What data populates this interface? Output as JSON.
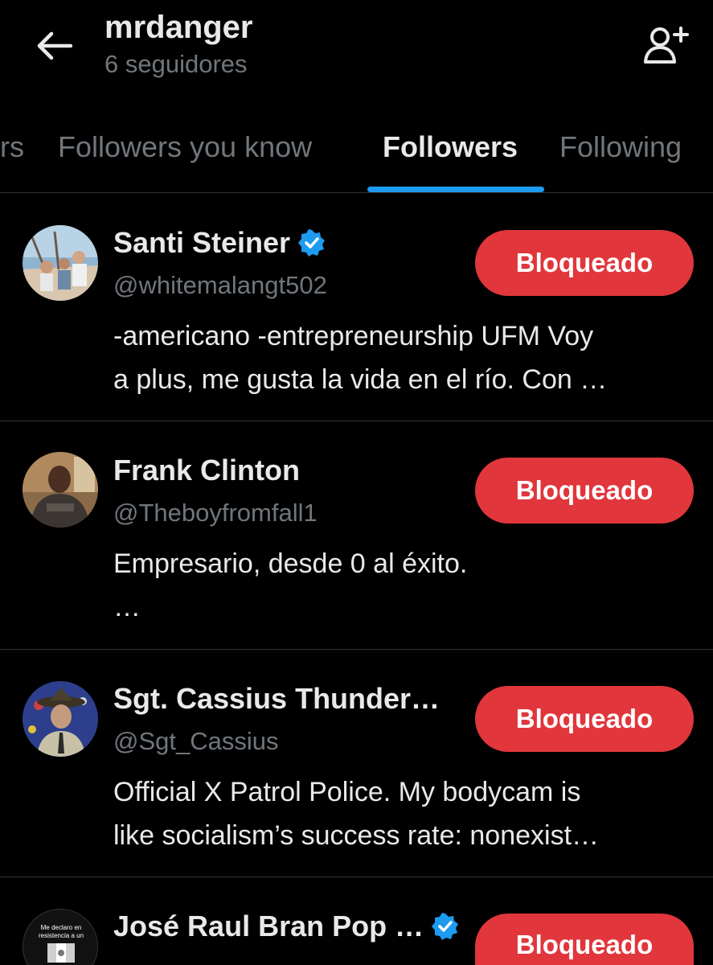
{
  "header": {
    "title": "mrdanger",
    "subtitle": "6 seguidores"
  },
  "tabs": [
    {
      "label": "rs"
    },
    {
      "label": "Followers you know"
    },
    {
      "label": "Followers"
    },
    {
      "label": "Following"
    }
  ],
  "active_tab": "Followers",
  "accounts": [
    {
      "name": "Santi Steiner",
      "verified": true,
      "handle": "@whitemalangt502",
      "bio_line1": "-americano -entrepreneurship UFM Voy",
      "bio_line2": "a plus, me gusta la vida en el río. Con …",
      "button_label": "Bloqueado"
    },
    {
      "name": "Frank Clinton",
      "verified": false,
      "handle": "@Theboyfromfall1",
      "bio_line1": "Empresario, desde 0 al éxito.",
      "bio_line2": "…",
      "button_label": "Bloqueado"
    },
    {
      "name": "Sgt. Cassius Thunder…",
      "verified": false,
      "handle": "@Sgt_Cassius",
      "bio_line1": "Official X Patrol Police. My bodycam is",
      "bio_line2": "like socialism’s success rate: nonexist…",
      "button_label": "Bloqueado"
    },
    {
      "name": "José Raul Bran Pop …",
      "verified": true,
      "avatar_text_1": "Me declaro en",
      "avatar_text_2": "resistencia a un",
      "button_label": "Bloqueado"
    }
  ],
  "icons": {
    "back": "arrow-left-icon",
    "add_user": "add-user-icon",
    "verified": "verified-badge-icon"
  },
  "colors": {
    "background": "#000000",
    "primary_text": "#e7e9ea",
    "secondary_text": "#71767b",
    "accent": "#1d9bf0",
    "blocked_button": "#e0363c",
    "divider": "#2f3336"
  }
}
